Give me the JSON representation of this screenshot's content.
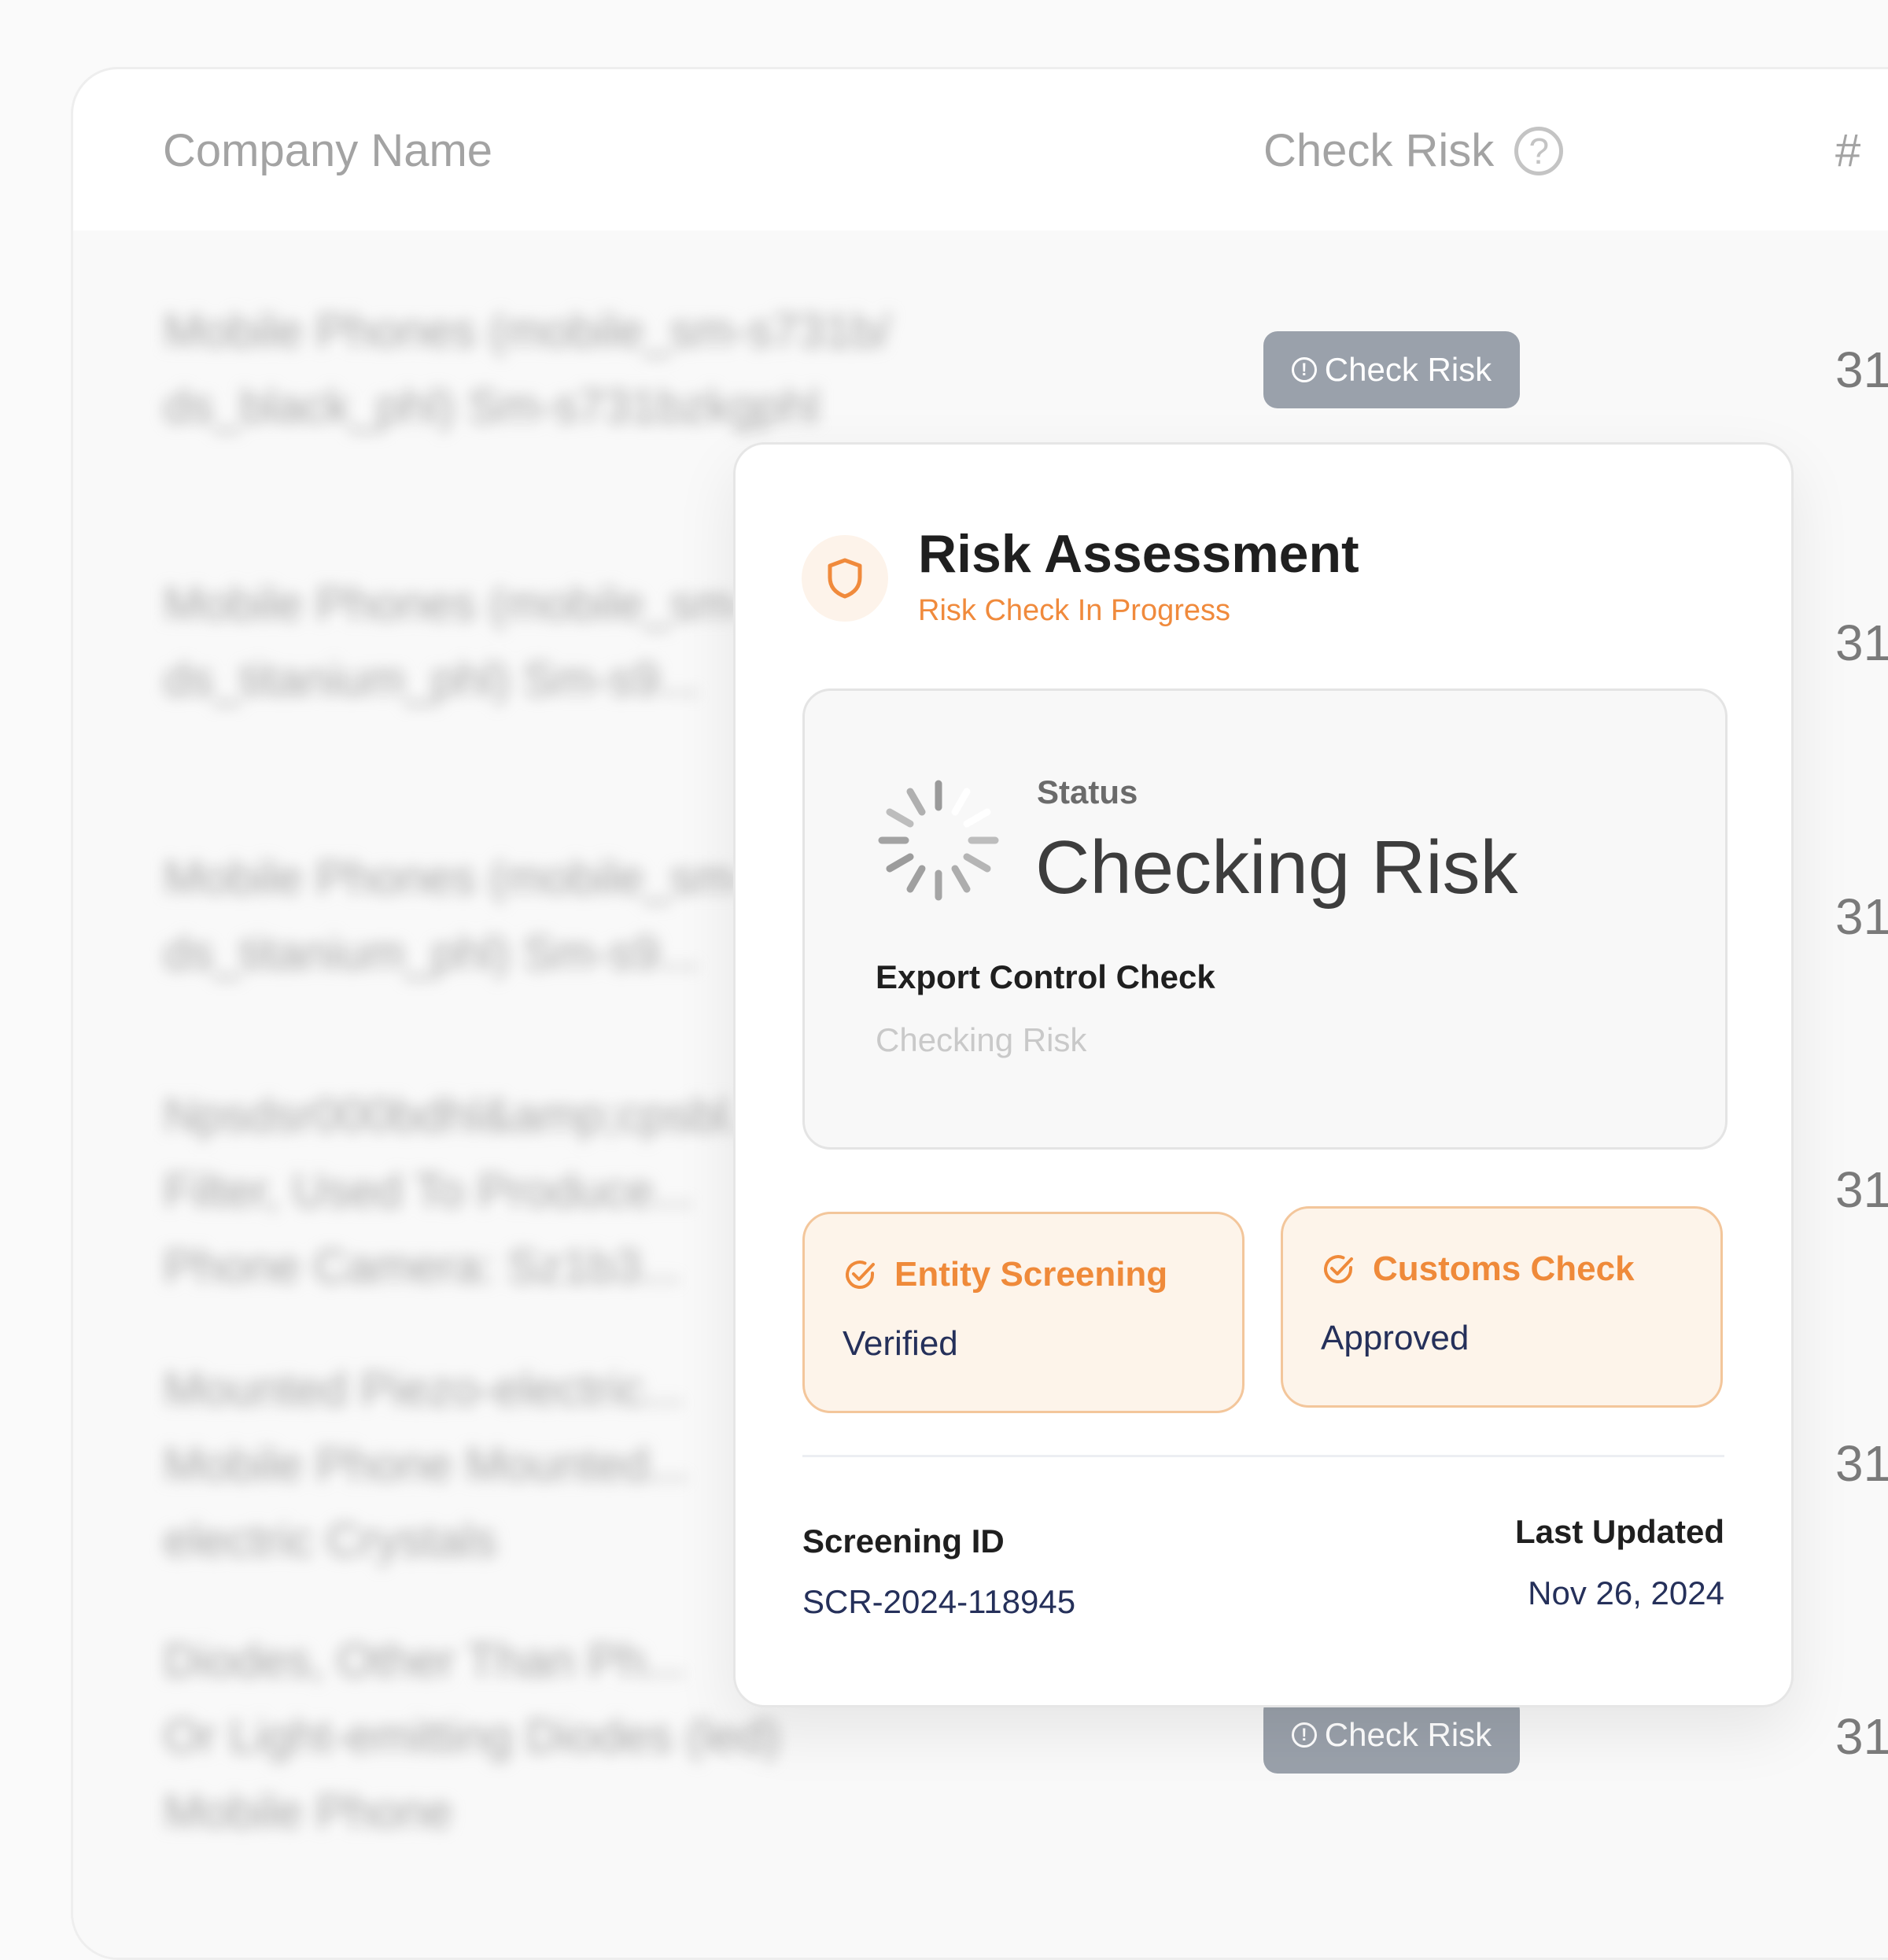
{
  "table": {
    "headers": {
      "company_name": "Company Name",
      "check_risk": "Check Risk",
      "number": "#"
    },
    "rows": [
      {
        "company": "Mobile Phones (mobile_sm-s731b/\nds_black_phl) Sm-s731bzkgphl",
        "number": "31"
      },
      {
        "company": "Mobile Phones (mobile_sm-s...\nds_titanium_phl) Sm-s9...",
        "number": "31"
      },
      {
        "company": "Mobile Phones (mobile_sm-s...\nds_titanium_phl) Sm-s9...",
        "number": "31"
      },
      {
        "company": "Npsdsr000bdhl&amp;cpsbl...\nFilter, Used To Produce...\nPhone Camera: Sz1b3...",
        "number": "31"
      },
      {
        "company": "Mounted Piezo-electric...\nMobile Phone Mounted...\nelectric Crystals",
        "number": "31"
      },
      {
        "company": "Diodes, Other Than Ph...\nOr Light-emitting Diodes (led)\nMobile Phone",
        "number": "31"
      }
    ],
    "button_label": "Check Risk"
  },
  "popup": {
    "title": "Risk Assessment",
    "subtitle": "Risk Check In Progress",
    "status": {
      "label": "Status",
      "value": "Checking Risk",
      "check_title": "Export Control Check",
      "check_sub": "Checking Risk"
    },
    "entity": {
      "title": "Entity Screening",
      "value": "Verified"
    },
    "customs": {
      "title": "Customs Check",
      "value": "Approved"
    },
    "screening_id": {
      "label": "Screening ID",
      "value": "SCR-2024-118945"
    },
    "last_updated": {
      "label": "Last Updated",
      "value": "Nov 26, 2024"
    }
  },
  "colors": {
    "accent": "#f08a3c",
    "button": "#9aa1ab",
    "navy_text": "#25305a"
  }
}
